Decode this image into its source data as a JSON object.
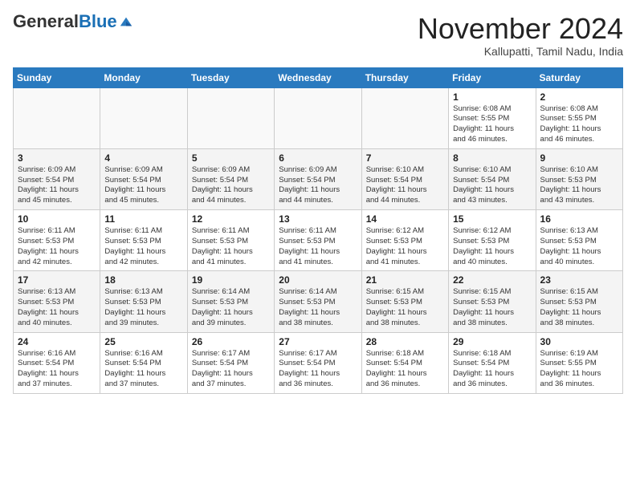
{
  "logo": {
    "general": "General",
    "blue": "Blue"
  },
  "title": "November 2024",
  "location": "Kallupatti, Tamil Nadu, India",
  "weekdays": [
    "Sunday",
    "Monday",
    "Tuesday",
    "Wednesday",
    "Thursday",
    "Friday",
    "Saturday"
  ],
  "weeks": [
    [
      {
        "day": "",
        "info": ""
      },
      {
        "day": "",
        "info": ""
      },
      {
        "day": "",
        "info": ""
      },
      {
        "day": "",
        "info": ""
      },
      {
        "day": "",
        "info": ""
      },
      {
        "day": "1",
        "info": "Sunrise: 6:08 AM\nSunset: 5:55 PM\nDaylight: 11 hours\nand 46 minutes."
      },
      {
        "day": "2",
        "info": "Sunrise: 6:08 AM\nSunset: 5:55 PM\nDaylight: 11 hours\nand 46 minutes."
      }
    ],
    [
      {
        "day": "3",
        "info": "Sunrise: 6:09 AM\nSunset: 5:54 PM\nDaylight: 11 hours\nand 45 minutes."
      },
      {
        "day": "4",
        "info": "Sunrise: 6:09 AM\nSunset: 5:54 PM\nDaylight: 11 hours\nand 45 minutes."
      },
      {
        "day": "5",
        "info": "Sunrise: 6:09 AM\nSunset: 5:54 PM\nDaylight: 11 hours\nand 44 minutes."
      },
      {
        "day": "6",
        "info": "Sunrise: 6:09 AM\nSunset: 5:54 PM\nDaylight: 11 hours\nand 44 minutes."
      },
      {
        "day": "7",
        "info": "Sunrise: 6:10 AM\nSunset: 5:54 PM\nDaylight: 11 hours\nand 44 minutes."
      },
      {
        "day": "8",
        "info": "Sunrise: 6:10 AM\nSunset: 5:54 PM\nDaylight: 11 hours\nand 43 minutes."
      },
      {
        "day": "9",
        "info": "Sunrise: 6:10 AM\nSunset: 5:53 PM\nDaylight: 11 hours\nand 43 minutes."
      }
    ],
    [
      {
        "day": "10",
        "info": "Sunrise: 6:11 AM\nSunset: 5:53 PM\nDaylight: 11 hours\nand 42 minutes."
      },
      {
        "day": "11",
        "info": "Sunrise: 6:11 AM\nSunset: 5:53 PM\nDaylight: 11 hours\nand 42 minutes."
      },
      {
        "day": "12",
        "info": "Sunrise: 6:11 AM\nSunset: 5:53 PM\nDaylight: 11 hours\nand 41 minutes."
      },
      {
        "day": "13",
        "info": "Sunrise: 6:11 AM\nSunset: 5:53 PM\nDaylight: 11 hours\nand 41 minutes."
      },
      {
        "day": "14",
        "info": "Sunrise: 6:12 AM\nSunset: 5:53 PM\nDaylight: 11 hours\nand 41 minutes."
      },
      {
        "day": "15",
        "info": "Sunrise: 6:12 AM\nSunset: 5:53 PM\nDaylight: 11 hours\nand 40 minutes."
      },
      {
        "day": "16",
        "info": "Sunrise: 6:13 AM\nSunset: 5:53 PM\nDaylight: 11 hours\nand 40 minutes."
      }
    ],
    [
      {
        "day": "17",
        "info": "Sunrise: 6:13 AM\nSunset: 5:53 PM\nDaylight: 11 hours\nand 40 minutes."
      },
      {
        "day": "18",
        "info": "Sunrise: 6:13 AM\nSunset: 5:53 PM\nDaylight: 11 hours\nand 39 minutes."
      },
      {
        "day": "19",
        "info": "Sunrise: 6:14 AM\nSunset: 5:53 PM\nDaylight: 11 hours\nand 39 minutes."
      },
      {
        "day": "20",
        "info": "Sunrise: 6:14 AM\nSunset: 5:53 PM\nDaylight: 11 hours\nand 38 minutes."
      },
      {
        "day": "21",
        "info": "Sunrise: 6:15 AM\nSunset: 5:53 PM\nDaylight: 11 hours\nand 38 minutes."
      },
      {
        "day": "22",
        "info": "Sunrise: 6:15 AM\nSunset: 5:53 PM\nDaylight: 11 hours\nand 38 minutes."
      },
      {
        "day": "23",
        "info": "Sunrise: 6:15 AM\nSunset: 5:53 PM\nDaylight: 11 hours\nand 38 minutes."
      }
    ],
    [
      {
        "day": "24",
        "info": "Sunrise: 6:16 AM\nSunset: 5:54 PM\nDaylight: 11 hours\nand 37 minutes."
      },
      {
        "day": "25",
        "info": "Sunrise: 6:16 AM\nSunset: 5:54 PM\nDaylight: 11 hours\nand 37 minutes."
      },
      {
        "day": "26",
        "info": "Sunrise: 6:17 AM\nSunset: 5:54 PM\nDaylight: 11 hours\nand 37 minutes."
      },
      {
        "day": "27",
        "info": "Sunrise: 6:17 AM\nSunset: 5:54 PM\nDaylight: 11 hours\nand 36 minutes."
      },
      {
        "day": "28",
        "info": "Sunrise: 6:18 AM\nSunset: 5:54 PM\nDaylight: 11 hours\nand 36 minutes."
      },
      {
        "day": "29",
        "info": "Sunrise: 6:18 AM\nSunset: 5:54 PM\nDaylight: 11 hours\nand 36 minutes."
      },
      {
        "day": "30",
        "info": "Sunrise: 6:19 AM\nSunset: 5:55 PM\nDaylight: 11 hours\nand 36 minutes."
      }
    ]
  ]
}
